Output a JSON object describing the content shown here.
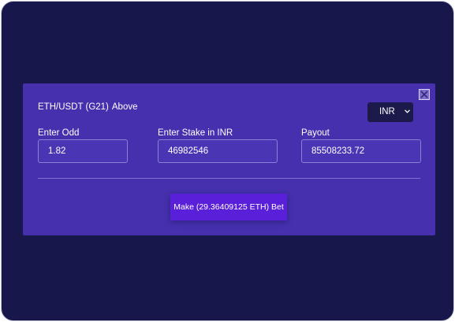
{
  "modal": {
    "title_pair": "ETH/USDT (G21)",
    "title_direction": "Above",
    "currency_select": {
      "selected": "INR",
      "icon": "chevron-down-icon"
    },
    "close_icon": "close-icon",
    "fields": {
      "odd": {
        "label": "Enter Odd",
        "value": "1.82"
      },
      "stake": {
        "label": "Enter Stake in INR",
        "value": "46982546"
      },
      "payout": {
        "label": "Payout",
        "value": "85508233.72"
      }
    },
    "bet_button_label": "Make (29.36409125 ETH) Bet"
  },
  "colors": {
    "backdrop": "#17174c",
    "modal": "#4630ae",
    "button": "#5a1fd8",
    "select": "#1b1a4a"
  }
}
